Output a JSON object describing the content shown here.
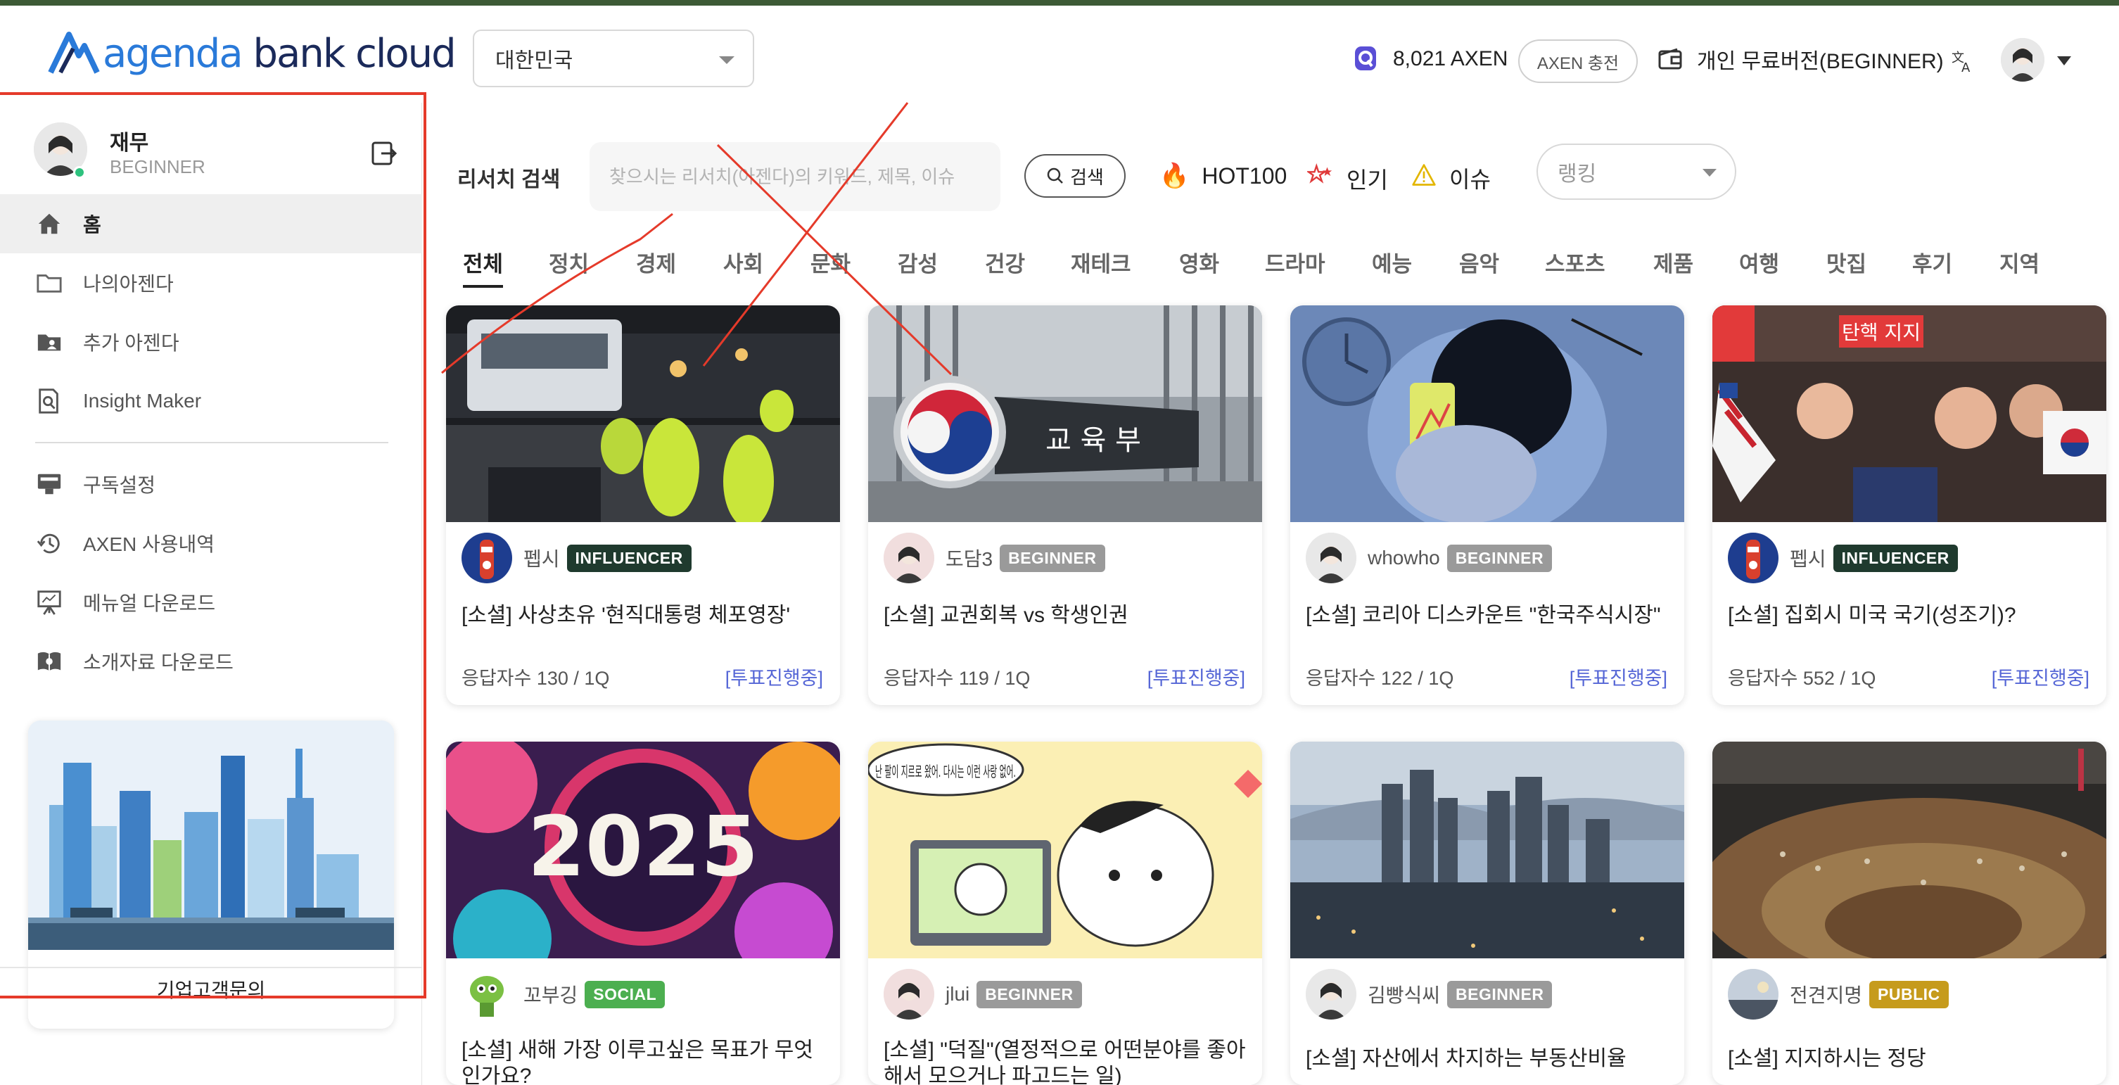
{
  "header": {
    "logo_text_1": "agenda",
    "logo_text_2": "bank cloud",
    "country": "대한민국",
    "axen_balance": "8,021 AXEN",
    "charge_label": "AXEN 충전",
    "plan_label": "개인 무료버전(BEGINNER)"
  },
  "sidebar": {
    "user_name": "재무",
    "user_tier": "BEGINNER",
    "items": [
      {
        "label": "홈",
        "icon": "home-icon"
      },
      {
        "label": "나의아젠다",
        "icon": "folder-icon"
      },
      {
        "label": "추가 아젠다",
        "icon": "folder-user-icon"
      },
      {
        "label": "Insight Maker",
        "icon": "doc-search-icon"
      },
      {
        "label": "구독설정",
        "icon": "subscription-icon"
      },
      {
        "label": "AXEN 사용내역",
        "icon": "history-icon"
      },
      {
        "label": "메뉴얼 다운로드",
        "icon": "presentation-icon"
      },
      {
        "label": "소개자료 다운로드",
        "icon": "book-icon"
      }
    ],
    "card_label": "기업고객문의"
  },
  "main": {
    "research_label": "리서치 검색",
    "search_placeholder": "찾으시는 리서치(아젠다)의 키워드, 제목, 이슈",
    "search_button": "검색",
    "quick_links": [
      "HOT100",
      "인기",
      "이슈"
    ],
    "rank_placeholder": "랭킹",
    "categories": [
      "전체",
      "정치",
      "경제",
      "사회",
      "문화",
      "감성",
      "건강",
      "재테크",
      "영화",
      "드라마",
      "예능",
      "음악",
      "스포츠",
      "제품",
      "여행",
      "맛집",
      "후기",
      "지역"
    ]
  },
  "cards": [
    {
      "author": "펩시",
      "badge": "INFLUENCER",
      "title": "[소셜] 사상초유 '현직대통령 체포영장'",
      "meta": "응답자수 130 / 1Q",
      "status": "[투표진행중]"
    },
    {
      "author": "도담3",
      "badge": "BEGINNER",
      "title": "[소셜] 교권회복 vs 학생인권",
      "meta": "응답자수 119 / 1Q",
      "status": "[투표진행중]",
      "image_text": "교 육 부"
    },
    {
      "author": "whowho",
      "badge": "BEGINNER",
      "title": "[소셜] 코리아 디스카운트 \"한국주식시장\"",
      "meta": "응답자수 122 / 1Q",
      "status": "[투표진행중]"
    },
    {
      "author": "펩시",
      "badge": "INFLUENCER",
      "title": "[소셜] 집회시 미국 국기(성조기)?",
      "meta": "응답자수 552 / 1Q",
      "status": "[투표진행중]",
      "image_text": "탄핵 지지"
    },
    {
      "author": "꼬부깅",
      "badge": "SOCIAL",
      "title": "[소셜] 새해 가장 이루고싶은 목표가 무엇인가요?",
      "image_text": "2025"
    },
    {
      "author": "jlui",
      "badge": "BEGINNER",
      "title": "[소셜] \"덕질\"(열정적으로 어떤분야를 좋아해서 모으거나 파고드는 일)",
      "image_text": "난 팔이 지르로 왔어. 다시는 이런 사랑 없어."
    },
    {
      "author": "김빵식씨",
      "badge": "BEGINNER",
      "title": "[소셜] 자산에서 차지하는 부동산비율"
    },
    {
      "author": "전견지명",
      "badge": "PUBLIC",
      "title": "[소셜] 지지하시는 정당"
    }
  ],
  "colors": {
    "accent_blue": "#2a7ad9",
    "status_link": "#5566d6",
    "badge_influencer": "#1f3a2e",
    "badge_beginner": "#9a9a9a",
    "badge_social": "#4caf50",
    "badge_public": "#c69b1c",
    "annotation_red": "#e53a2a"
  }
}
